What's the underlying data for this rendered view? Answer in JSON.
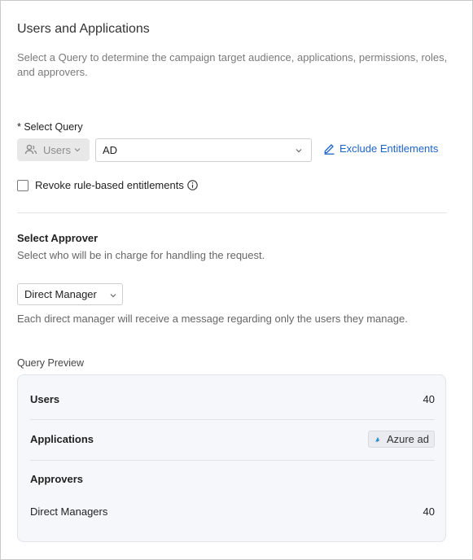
{
  "header": {
    "title": "Users and Applications",
    "subtitle": "Select a Query to determine the campaign target audience, applications, permissions, roles, and approvers."
  },
  "query": {
    "label": "* Select Query",
    "type_value": "Users",
    "query_value": "AD",
    "exclude_link": "Exclude Entitlements",
    "revoke_label": "Revoke rule-based entitlements",
    "revoke_checked": false
  },
  "approver": {
    "heading": "Select Approver",
    "description": "Select who will be in charge for handling the request.",
    "selected": "Direct Manager",
    "note": "Each direct manager will receive a message regarding only the users they manage."
  },
  "preview": {
    "label": "Query Preview",
    "users_label": "Users",
    "users_count": "40",
    "applications_label": "Applications",
    "application_chip": "Azure ad",
    "approvers_label": "Approvers",
    "direct_managers_label": "Direct Managers",
    "direct_managers_count": "40"
  },
  "icons": {
    "users_type": "users-icon",
    "edit": "pencil-icon",
    "info": "info-icon",
    "azure": "azure-logo-icon",
    "dropdown": "chevron-down-icon"
  },
  "colors": {
    "link": "#1d64c8",
    "preview_bg": "#f6f7fa",
    "disabled_select_bg": "#e8e8e8"
  }
}
